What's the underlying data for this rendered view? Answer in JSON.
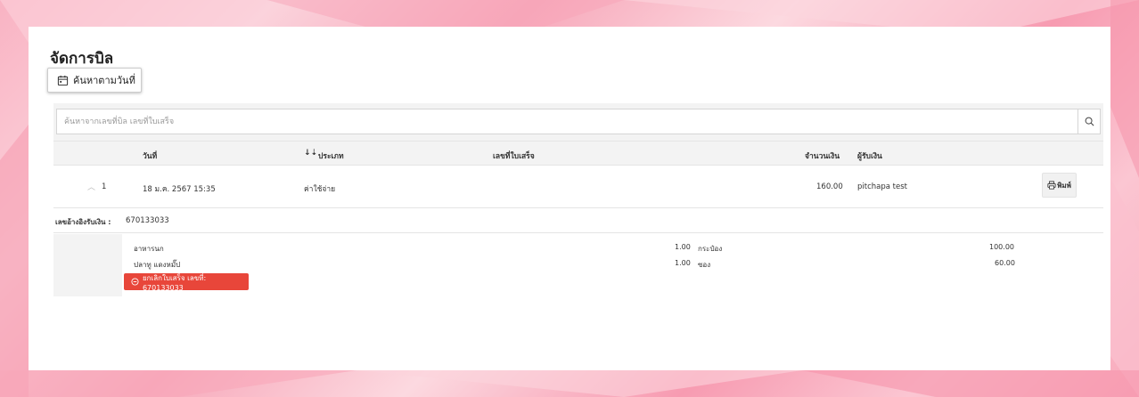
{
  "page": {
    "title": "จัดการบิล",
    "date_search_label": "ค้นหาตามวันที่"
  },
  "search": {
    "placeholder": "ค้นหาจากเลขที่บิล เลขที่ใบเสร็จ"
  },
  "table": {
    "headers": {
      "date": "วันที่",
      "type": "ประเภท",
      "receipt_no": "เลขที่ใบเสร็จ",
      "amount": "จำนวนเงิน",
      "receiver": "ผู้รับเงิน"
    },
    "rows": [
      {
        "index": "1",
        "date": "18 ม.ค. 2567 15:35",
        "type": "ค่าใช้จ่าย",
        "receipt_no": "",
        "amount": "160.00",
        "receiver": "pitchapa test",
        "print_label": "พิมพ์"
      }
    ]
  },
  "detail": {
    "ref_label": "เลขอ้างอิงรับเงิน :",
    "ref_value": "670133033",
    "items": [
      {
        "name": "อาหารนก",
        "qty": "1.00",
        "unit": "กระป๋อง",
        "price": "100.00"
      },
      {
        "name": "ปลาทู แดงหมั๊ป",
        "qty": "1.00",
        "unit": "ซอง",
        "price": "60.00"
      }
    ],
    "cancel_label": "ยกเลิกใบเสร็จ เลขที่: 670133033"
  },
  "colors": {
    "danger": "#e8463a",
    "header_bg": "#f3f3f3"
  }
}
